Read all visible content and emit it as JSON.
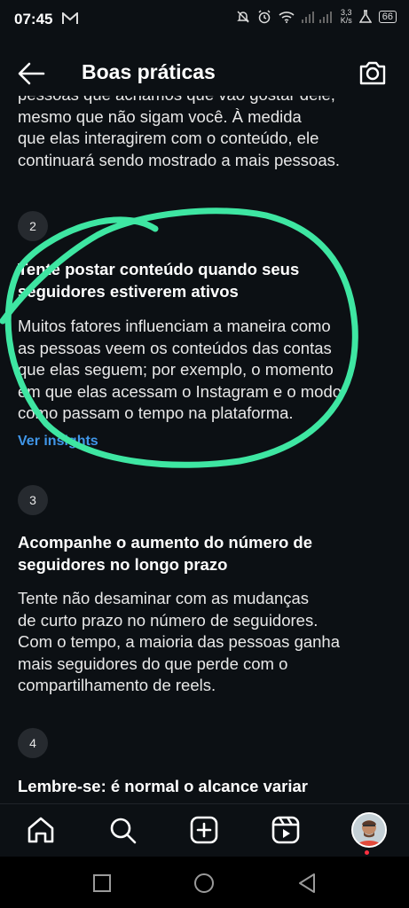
{
  "status_bar": {
    "time": "07:45",
    "data_rate_value": "3,3",
    "data_rate_unit": "K/s",
    "battery": "66"
  },
  "header": {
    "title": "Boas práticas"
  },
  "content": {
    "intro_lines": [
      "pessoas que achamos que vão gostar dele,",
      "mesmo que não sigam você. À medida",
      "que elas interagirem com o conteúdo, ele",
      "continuará sendo mostrado a mais pessoas."
    ],
    "tips": [
      {
        "number": "2",
        "title_lines": [
          "Tente postar conteúdo quando seus",
          "seguidores estiverem ativos"
        ],
        "body_lines": [
          "Muitos fatores influenciam a maneira como",
          "as pessoas veem os conteúdos das contas",
          "que elas seguem; por exemplo, o momento",
          "em que elas acessam o Instagram e o modo",
          "como passam o tempo na plataforma."
        ],
        "link": "Ver insights"
      },
      {
        "number": "3",
        "title_lines": [
          "Acompanhe o aumento do número de",
          "seguidores no longo prazo"
        ],
        "body_lines": [
          "Tente não desaminar com as mudanças",
          "de curto prazo no número de seguidores.",
          "Com o tempo, a maioria das pessoas ganha",
          "mais seguidores do que perde com o",
          "compartilhamento de reels."
        ]
      },
      {
        "number": "4",
        "title_lines": [
          "Lembre-se: é normal o alcance variar"
        ]
      }
    ]
  },
  "colors": {
    "background": "#0c1014",
    "link": "#4096e8",
    "annotation": "#3ee6a2",
    "badge": "#262a2f"
  }
}
